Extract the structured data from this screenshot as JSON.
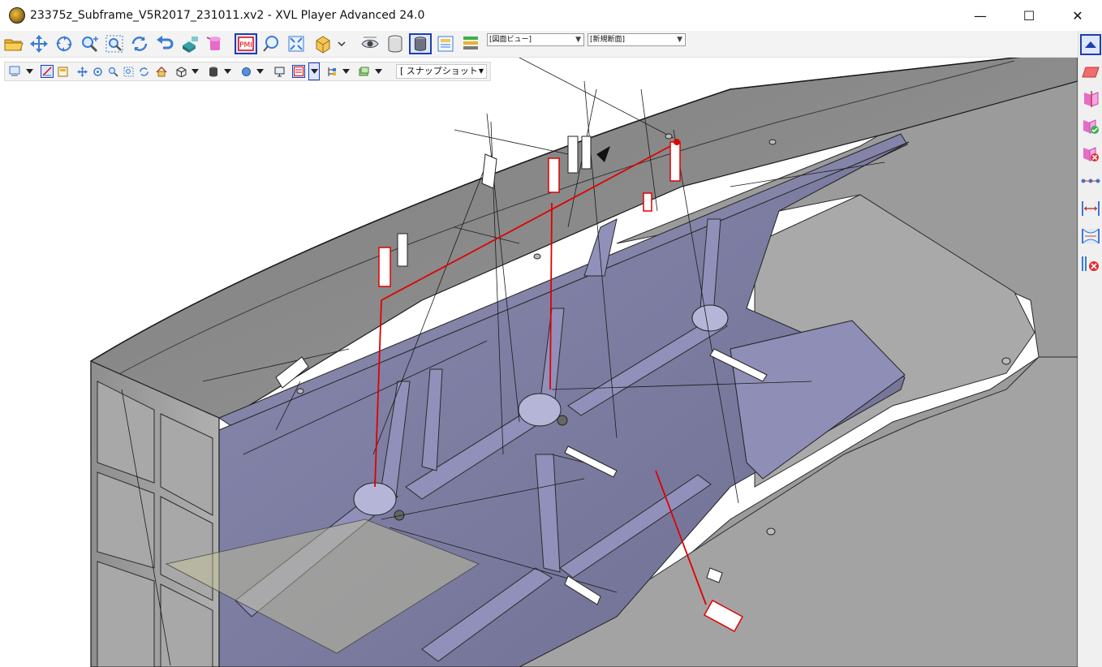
{
  "window": {
    "title": "23375z_Subframe_V5R2017_231011.xv2 - XVL Player Advanced 24.0",
    "app_icon": "xvl-player-icon",
    "controls": {
      "minimize": "—",
      "maximize": "☐",
      "close": "✕"
    }
  },
  "toolbar_main": {
    "icons": [
      "open-folder-icon",
      "pan-icon",
      "rotate-icon",
      "zoom-icon",
      "zoom-fit-icon",
      "rotate-free-icon",
      "undo-icon",
      "cad-view-icon",
      "highlight-icon",
      "pmi-icon",
      "balloon-icon",
      "fit-all-icon",
      "view-direction-icon",
      "visibility-icon",
      "cylinder-icon",
      "cylinder-solid-icon",
      "table-icon",
      "layer-icon"
    ],
    "view_combo": {
      "value": "[図面ビュー]"
    },
    "section_combo": {
      "value": "[新規断面]"
    }
  },
  "toolbar_secondary": {
    "snapshot_label": "[ スナップショット",
    "icons": [
      "select-icon",
      "measure-icon",
      "markup-icon",
      "pan-small-icon",
      "move-icon",
      "zoom-small-icon",
      "zoom-area-icon",
      "rotate-small-icon",
      "home-icon",
      "box-icon",
      "cylinder-small-icon",
      "sphere-icon",
      "monitor-icon",
      "pmi-small-icon",
      "parts-tree-icon",
      "layers-small-icon"
    ]
  },
  "right_panel": {
    "icons": [
      "collapse-up-icon",
      "eraser-icon",
      "section-plane-icon",
      "section-ok-icon",
      "section-delete-icon",
      "distance-points-icon",
      "width-measure-icon",
      "height-measure-icon",
      "clearance-delete-icon"
    ]
  },
  "colors": {
    "titlebar_bg": "#ffffff",
    "toolbar_bg": "#f3f3f3",
    "accent_blue": "#1c3fb0",
    "part_gray": "#8a8a8a",
    "part_face": "#7f7fa5",
    "pmi_red": "#e00000"
  }
}
